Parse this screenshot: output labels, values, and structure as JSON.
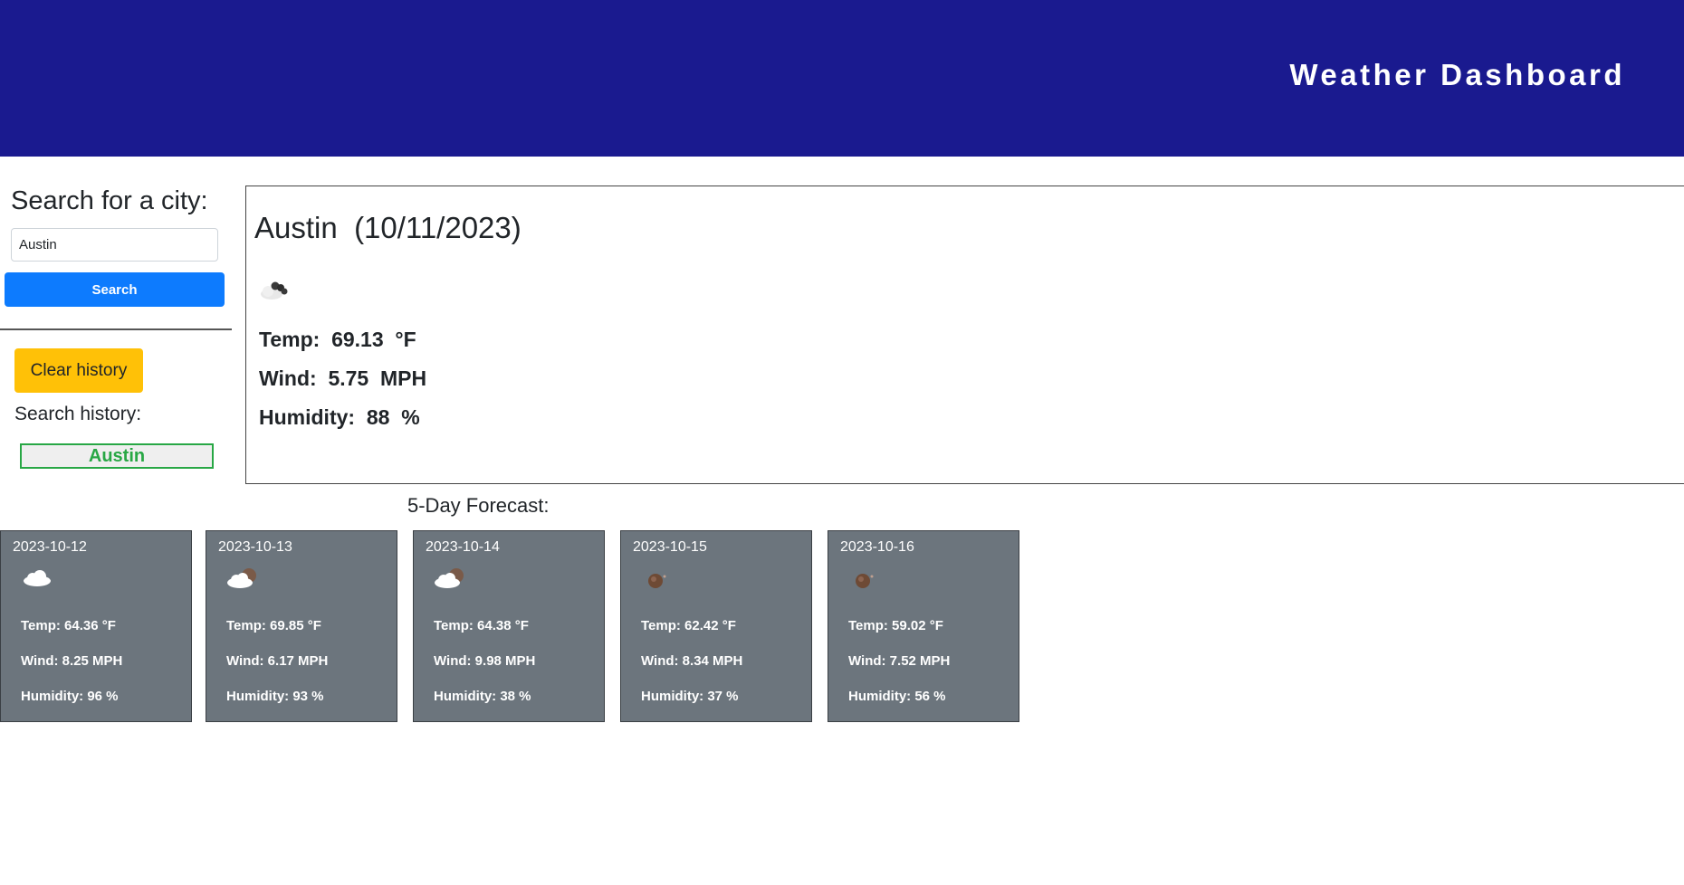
{
  "header": {
    "title": "Weather Dashboard"
  },
  "sidebar": {
    "search_heading": "Search for a city:",
    "input_value": "Austin",
    "search_label": "Search",
    "clear_label": "Clear history",
    "history_heading": "Search history:",
    "history_items": [
      "Austin"
    ]
  },
  "current": {
    "city": "Austin",
    "date": "(10/11/2023)",
    "icon": "cloudy-icon",
    "temp_label": "Temp:",
    "temp_value": "69.13",
    "temp_unit": "°F",
    "wind_label": "Wind:",
    "wind_value": "5.75",
    "wind_unit": "MPH",
    "humidity_label": "Humidity:",
    "humidity_value": "88",
    "humidity_unit": "%"
  },
  "forecast": {
    "heading": "5-Day Forecast:",
    "days": [
      {
        "date": "2023-10-12",
        "icon": "cloud-icon",
        "temp": "Temp: 64.36 °F",
        "wind": "Wind: 8.25 MPH",
        "humidity": "Humidity: 96 %"
      },
      {
        "date": "2023-10-13",
        "icon": "partly-cloudy-night-icon",
        "temp": "Temp: 69.85 °F",
        "wind": "Wind: 6.17 MPH",
        "humidity": "Humidity: 93 %"
      },
      {
        "date": "2023-10-14",
        "icon": "partly-cloudy-night-icon",
        "temp": "Temp: 64.38 °F",
        "wind": "Wind: 9.98 MPH",
        "humidity": "Humidity: 38 %"
      },
      {
        "date": "2023-10-15",
        "icon": "clear-night-icon",
        "temp": "Temp: 62.42 °F",
        "wind": "Wind: 8.34 MPH",
        "humidity": "Humidity: 37 %"
      },
      {
        "date": "2023-10-16",
        "icon": "clear-night-icon",
        "temp": "Temp: 59.02 °F",
        "wind": "Wind: 7.52 MPH",
        "humidity": "Humidity: 56 %"
      }
    ]
  }
}
